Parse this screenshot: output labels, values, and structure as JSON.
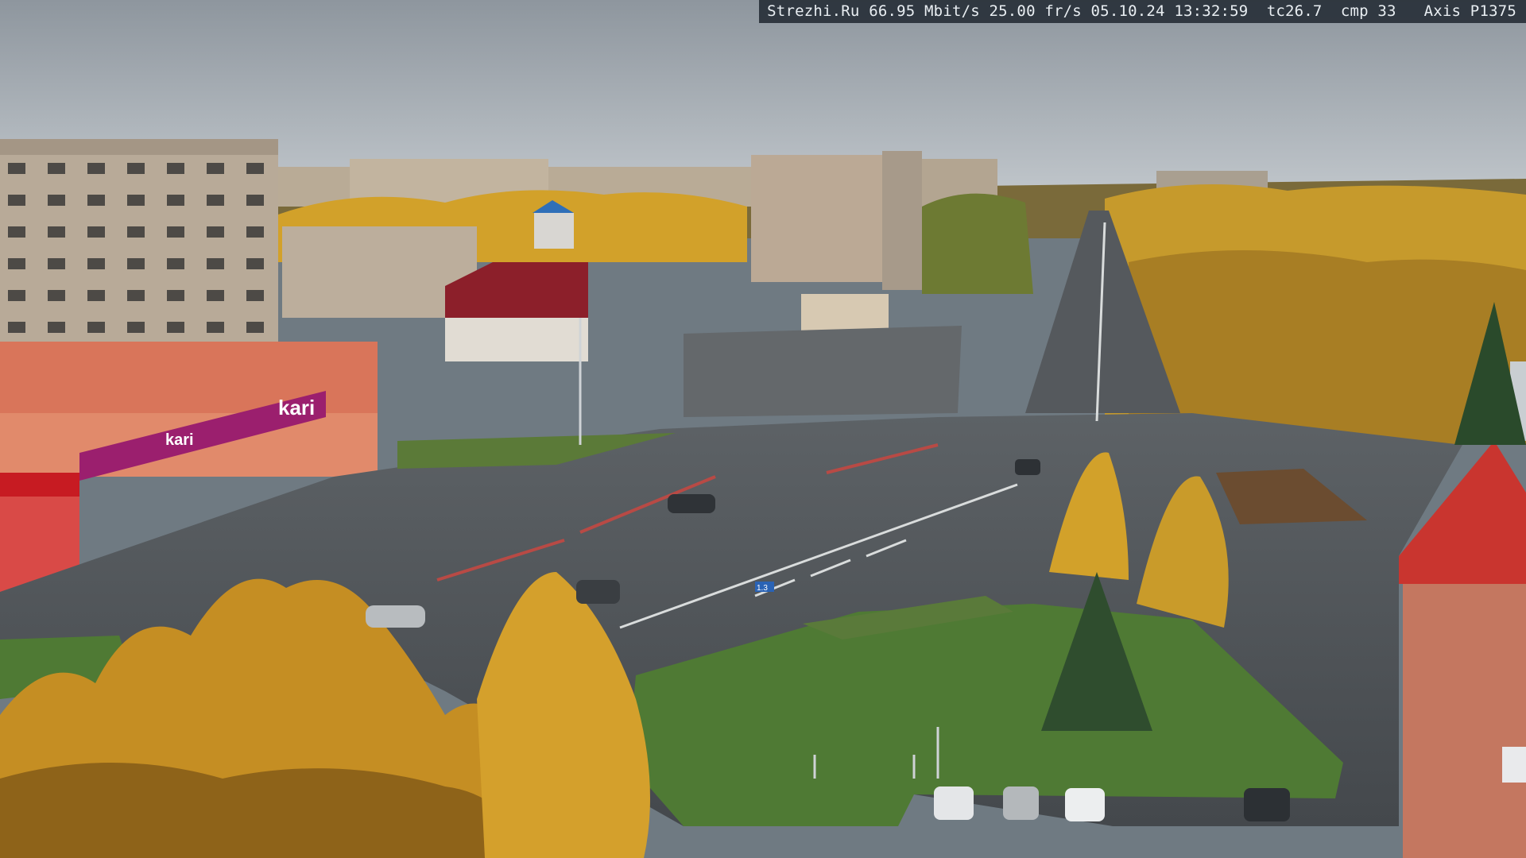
{
  "camera_overlay": {
    "site": "Strezhi.Ru",
    "bitrate": "66.95 Mbit/s",
    "framerate": "25.00 fr/s",
    "date": "05.10.24",
    "time": "13:32:59",
    "tc": "tc26.7",
    "cmp": "cmp 33",
    "camera_model": "Axis P1375"
  },
  "signs": {
    "store_kari_upper": "kari",
    "store_kari_lower": "kari",
    "road_sign": "1.3"
  },
  "colors": {
    "sky": "#a9b0b7",
    "asphalt": "#4d5257",
    "autumn_yellow": "#d2a12a",
    "grass": "#4f7a34",
    "kari_magenta": "#9b1f6e",
    "building_red": "#c9352f"
  }
}
